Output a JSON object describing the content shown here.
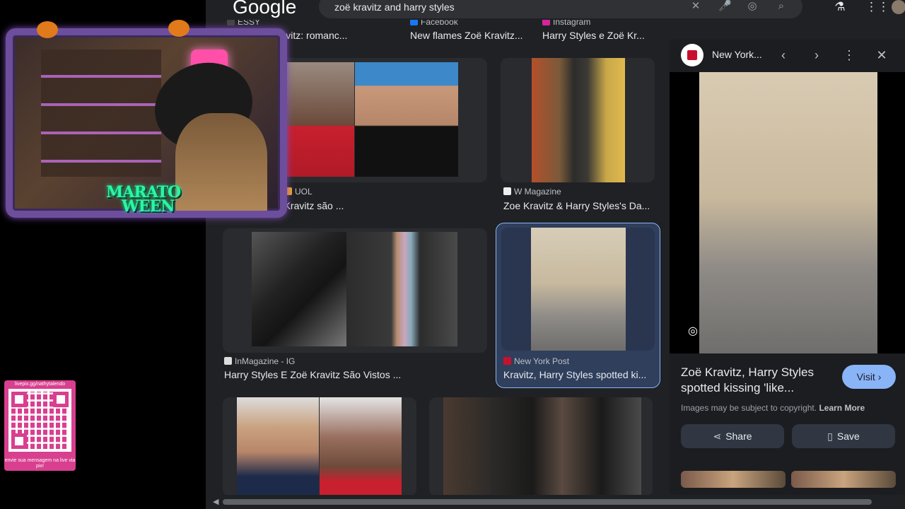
{
  "overlay": {
    "marato_line1": "MARATO",
    "marato_line2": "WEEN",
    "qr_url": "livepix.gg/nathytalendo",
    "qr_caption": "envie sua mensagem na live via pix!"
  },
  "header": {
    "logo": "Google",
    "search_value": "zoë kravitz and harry styles",
    "clear_icon": "✕",
    "mic_icon": "🎤",
    "lens_icon": "◎",
    "search_icon": "⌕",
    "labs_icon": "⚗",
    "apps_icon": "⋮⋮"
  },
  "results": {
    "top_row": [
      {
        "source": "ESSY",
        "title": "les e Zoë Kravitz: romanc..."
      },
      {
        "source": "Facebook",
        "title": "New flames Zoë Kravitz..."
      },
      {
        "source": "Instagram",
        "title": "Harry Styles e Zoë Kr..."
      }
    ],
    "row2": [
      {
        "source": "UOL",
        "title": "s e Zoë Kravitz são ..."
      },
      {
        "source": "W Magazine",
        "title": "Zoe Kravitz & Harry Styles's Da..."
      }
    ],
    "row3": [
      {
        "source": "InMagazine - IG",
        "title": "Harry Styles E Zoë Kravitz São Vistos ..."
      },
      {
        "source": "New York Post",
        "title": "Kravitz, Harry Styles spotted ki..."
      }
    ]
  },
  "panel": {
    "source": "New York...",
    "prev_icon": "‹",
    "next_icon": "›",
    "more_icon": "⋮",
    "close_icon": "✕",
    "title": "Zoë Kravitz, Harry Styles spotted kissing 'like...",
    "visit_label": "Visit ›",
    "copyright": "Images may be subject to copyright.",
    "learn_more": "Learn More",
    "share_label": "Share",
    "save_label": "Save"
  },
  "colors": {
    "accent": "#8ab4f8",
    "page_bg": "#202124",
    "selected_card": "#2f3f5c"
  }
}
